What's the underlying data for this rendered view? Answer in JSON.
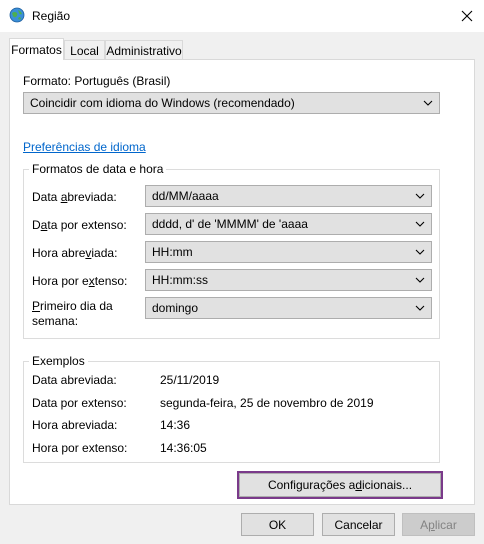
{
  "window": {
    "title": "Região"
  },
  "tabs": [
    {
      "label": "Formatos"
    },
    {
      "label": "Local"
    },
    {
      "label": "Administrativo"
    }
  ],
  "format": {
    "label": "Formato: Português (Brasil)",
    "value": "Coincidir com idioma do Windows (recomendado)"
  },
  "language_prefs_link": "Preferências de idioma",
  "date_time_group": {
    "title": "Formatos de data e hora",
    "short_date": {
      "label_pre": "Data ",
      "label_mn": "a",
      "label_post": "breviada:",
      "value": "dd/MM/aaaa"
    },
    "long_date": {
      "label_pre": "D",
      "label_mn": "a",
      "label_post": "ta por extenso:",
      "value": "dddd, d' de 'MMMM' de 'aaaa"
    },
    "short_time": {
      "label_pre": "Hora abre",
      "label_mn": "v",
      "label_post": "iada:",
      "value": "HH:mm"
    },
    "long_time": {
      "label_pre": "Hora por e",
      "label_mn": "x",
      "label_post": "tenso:",
      "value": "HH:mm:ss"
    },
    "first_day": {
      "label_line1_mn": "P",
      "label_line1_rest": "rimeiro dia da",
      "label_line2": "semana:",
      "value": "domingo"
    }
  },
  "examples_group": {
    "title": "Exemplos",
    "rows": [
      {
        "label": "Data abreviada:",
        "value": "25/11/2019"
      },
      {
        "label": "Data por extenso:",
        "value": "segunda-feira, 25 de novembro de 2019"
      },
      {
        "label": "Hora abreviada:",
        "value": "14:36"
      },
      {
        "label": "Hora por extenso:",
        "value": "14:36:05"
      }
    ]
  },
  "buttons": {
    "additional_pre": "Configurações a",
    "additional_mn": "d",
    "additional_post": "icionais...",
    "ok": "OK",
    "cancel": "Cancelar",
    "apply_pre": "A",
    "apply_mn": "p",
    "apply_post": "licar"
  }
}
